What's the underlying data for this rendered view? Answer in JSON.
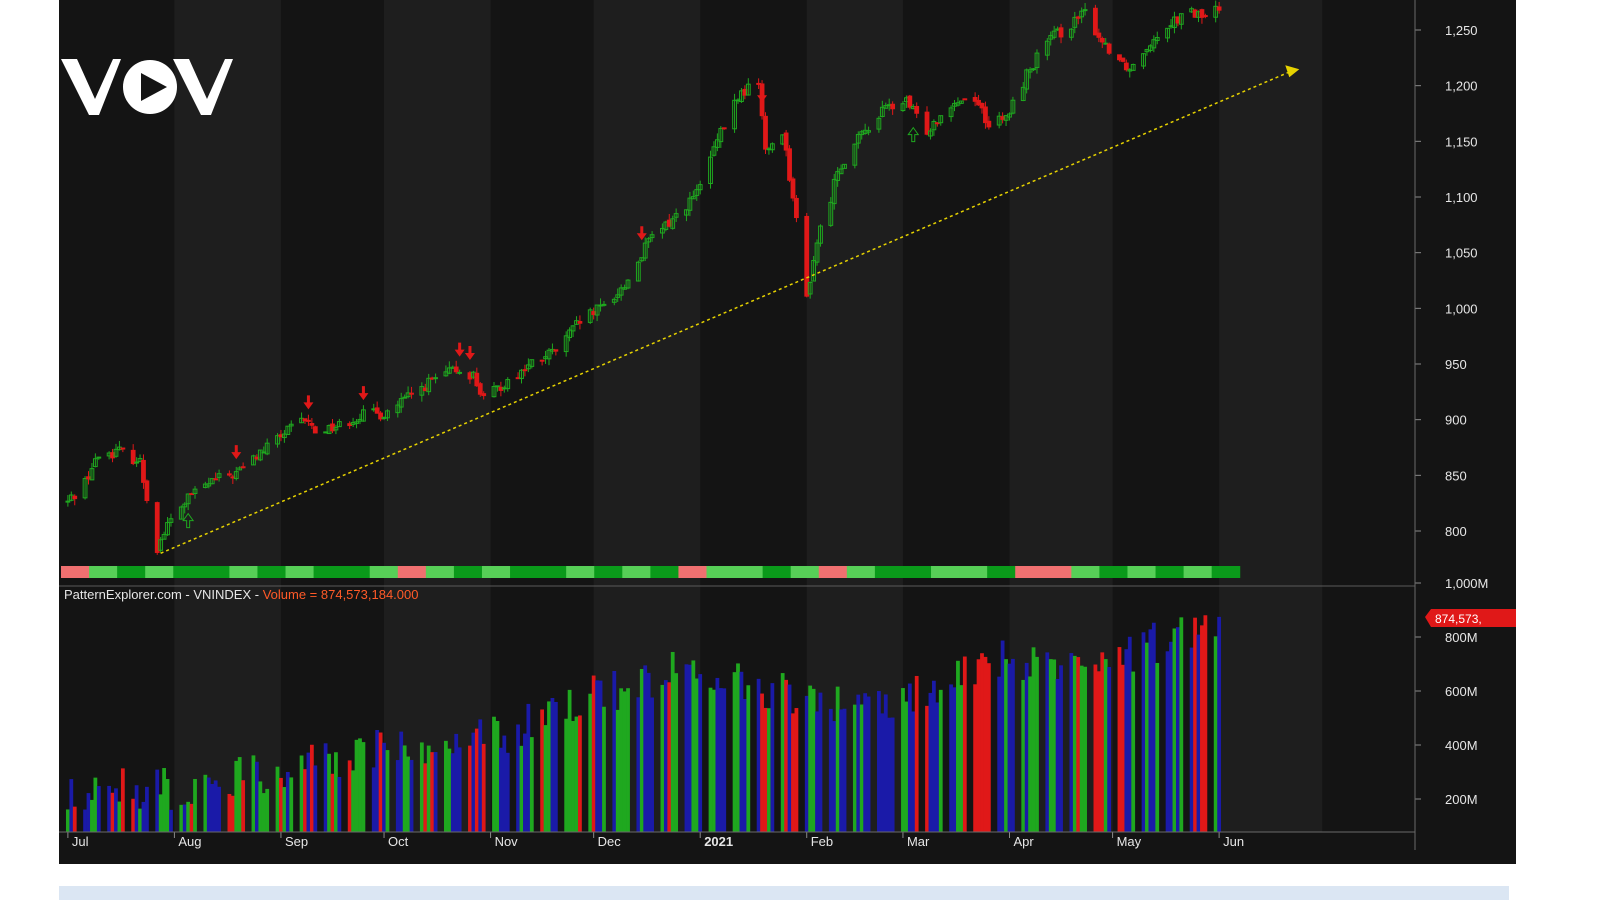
{
  "logo": {
    "text": "VOV",
    "icon": "play-triangle-icon"
  },
  "legend": {
    "source": "PatternExplorer.com",
    "separator": " - ",
    "symbol": "VNINDEX",
    "volume_text": "Volume = 874,573,184.000",
    "volume_badge": "874,573,"
  },
  "colors": {
    "background": "#141414",
    "band_alt": "#1e1e1e",
    "up": "#1fa81f",
    "down": "#e01818",
    "volume_neutral": "#1a1aa8",
    "trendline": "#e6d200",
    "signal_bar_green": "#0a9a1a",
    "signal_bar_light": "#57cf57",
    "signal_bar_red": "#f07070"
  },
  "chart_data": [
    {
      "type": "candlestick",
      "title": "VNINDEX",
      "ylim": [
        770,
        1265
      ],
      "y_ticks": [
        "800",
        "850",
        "900",
        "950",
        "1,000",
        "1,050",
        "1,100",
        "1,150",
        "1,200",
        "1,250"
      ],
      "months": [
        "Jul",
        "Aug",
        "Sep",
        "Oct",
        "Nov",
        "Dec",
        "2021",
        "Feb",
        "Mar",
        "Apr",
        "May",
        "Jun"
      ],
      "close_path": [
        [
          "2020-07-01",
          826
        ],
        [
          "2020-07-06",
          845
        ],
        [
          "2020-07-10",
          868
        ],
        [
          "2020-07-16",
          872
        ],
        [
          "2020-07-22",
          862
        ],
        [
          "2020-07-24",
          830
        ],
        [
          "2020-07-27",
          785
        ],
        [
          "2020-07-30",
          805
        ],
        [
          "2020-08-05",
          830
        ],
        [
          "2020-08-12",
          845
        ],
        [
          "2020-08-19",
          852
        ],
        [
          "2020-08-26",
          870
        ],
        [
          "2020-09-02",
          888
        ],
        [
          "2020-09-08",
          900
        ],
        [
          "2020-09-11",
          890
        ],
        [
          "2020-09-18",
          895
        ],
        [
          "2020-09-25",
          905
        ],
        [
          "2020-10-01",
          905
        ],
        [
          "2020-10-08",
          920
        ],
        [
          "2020-10-15",
          935
        ],
        [
          "2020-10-22",
          945
        ],
        [
          "2020-10-27",
          940
        ],
        [
          "2020-10-30",
          918
        ],
        [
          "2020-11-06",
          935
        ],
        [
          "2020-11-13",
          950
        ],
        [
          "2020-11-20",
          962
        ],
        [
          "2020-11-27",
          988
        ],
        [
          "2020-12-03",
          1000
        ],
        [
          "2020-12-10",
          1020
        ],
        [
          "2020-12-17",
          1060
        ],
        [
          "2020-12-24",
          1080
        ],
        [
          "2020-12-31",
          1103
        ],
        [
          "2021-01-06",
          1150
        ],
        [
          "2021-01-12",
          1190
        ],
        [
          "2021-01-18",
          1205
        ],
        [
          "2021-01-20",
          1140
        ],
        [
          "2021-01-25",
          1160
        ],
        [
          "2021-01-28",
          1100
        ],
        [
          "2021-02-01",
          1010
        ],
        [
          "2021-02-04",
          1060
        ],
        [
          "2021-02-08",
          1100
        ],
        [
          "2021-02-10",
          1125
        ],
        [
          "2021-02-18",
          1160
        ],
        [
          "2021-02-24",
          1180
        ],
        [
          "2021-03-02",
          1185
        ],
        [
          "2021-03-08",
          1160
        ],
        [
          "2021-03-15",
          1185
        ],
        [
          "2021-03-22",
          1190
        ],
        [
          "2021-03-26",
          1165
        ],
        [
          "2021-03-31",
          1170
        ],
        [
          "2021-04-06",
          1210
        ],
        [
          "2021-04-12",
          1240
        ],
        [
          "2021-04-19",
          1255
        ],
        [
          "2021-04-23",
          1265
        ],
        [
          "2021-04-28",
          1240
        ],
        [
          "2021-05-06",
          1215
        ],
        [
          "2021-05-12",
          1240
        ],
        [
          "2021-05-18",
          1258
        ],
        [
          "2021-05-24",
          1265
        ],
        [
          "2021-05-28",
          1262
        ],
        [
          "2021-06-01",
          1270
        ]
      ],
      "trendline": {
        "from": [
          "2020-07-28",
          780
        ],
        "to": [
          "2021-06-22",
          1213
        ]
      },
      "signal_arrows": [
        {
          "date": "2020-08-19",
          "dir": "down"
        },
        {
          "date": "2020-09-09",
          "dir": "down"
        },
        {
          "date": "2020-09-25",
          "dir": "down"
        },
        {
          "date": "2020-10-23",
          "dir": "down"
        },
        {
          "date": "2020-10-26",
          "dir": "down"
        },
        {
          "date": "2020-12-15",
          "dir": "down"
        },
        {
          "date": "2021-01-19",
          "dir": "down"
        },
        {
          "date": "2021-03-04",
          "dir": "up"
        },
        {
          "date": "2020-08-05",
          "dir": "up"
        }
      ]
    },
    {
      "type": "bar",
      "title": "Volume",
      "ylim": [
        120,
        1000
      ],
      "y_ticks": [
        "200M",
        "400M",
        "600M",
        "800M",
        "1,000M"
      ],
      "last_value": 874.573,
      "monthly_volume_approx": [
        [
          "Jul",
          230
        ],
        [
          "Aug",
          240
        ],
        [
          "Sep",
          300
        ],
        [
          "Oct",
          400
        ],
        [
          "Nov",
          420
        ],
        [
          "Dec",
          580
        ],
        [
          "2021",
          700
        ],
        [
          "Feb",
          560
        ],
        [
          "Mar",
          560
        ],
        [
          "Apr",
          720
        ],
        [
          "May",
          720
        ],
        [
          "Jun",
          860
        ]
      ]
    }
  ]
}
